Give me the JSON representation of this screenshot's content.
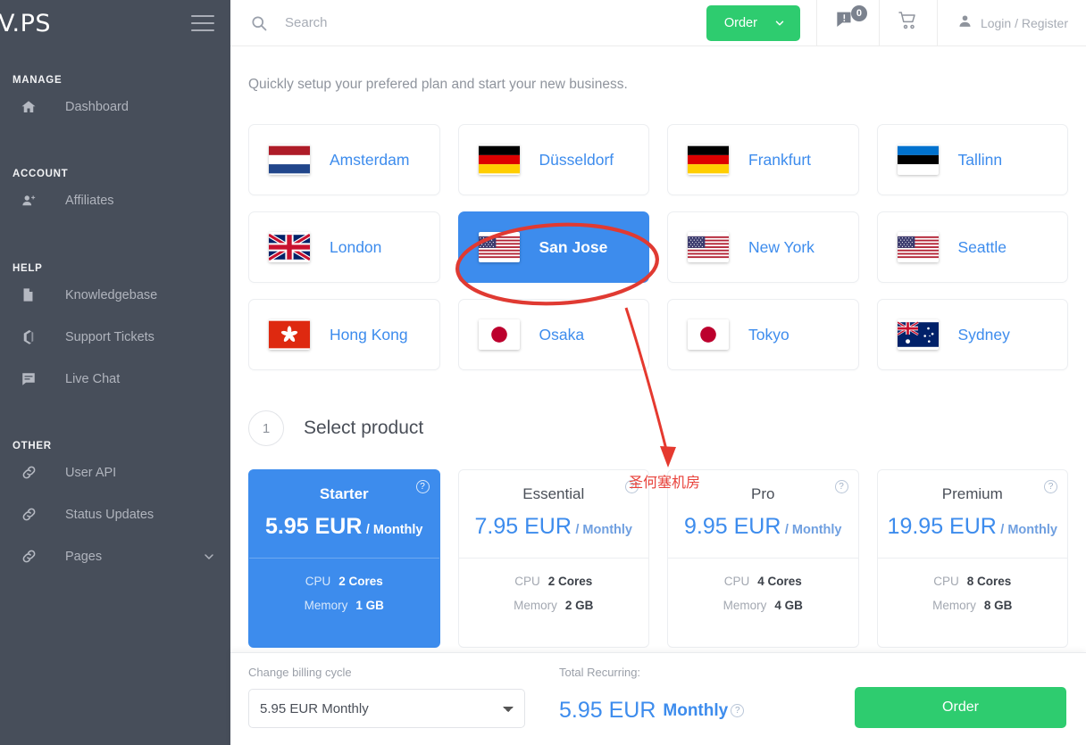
{
  "sidebar": {
    "brand": "V.PS",
    "menu_icon": "hamburger-icon",
    "sections": [
      {
        "title": "MANAGE",
        "items": [
          {
            "label": "Dashboard",
            "icon": "home-icon"
          }
        ]
      },
      {
        "title": "ACCOUNT",
        "items": [
          {
            "label": "Affiliates",
            "icon": "users-add-icon"
          }
        ]
      },
      {
        "title": "HELP",
        "items": [
          {
            "label": "Knowledgebase",
            "icon": "document-icon"
          },
          {
            "label": "Support Tickets",
            "icon": "ticket-icon"
          },
          {
            "label": "Live Chat",
            "icon": "chat-icon"
          }
        ]
      },
      {
        "title": "OTHER",
        "items": [
          {
            "label": "User API",
            "icon": "link-icon"
          },
          {
            "label": "Status Updates",
            "icon": "link-icon"
          },
          {
            "label": "Pages",
            "icon": "link-icon",
            "chevron": "chevron-down-icon"
          }
        ]
      }
    ]
  },
  "header": {
    "search_placeholder": "Search",
    "search_value": "",
    "search_icon": "search-icon",
    "order_label": "Order",
    "order_chevron": "chevron-down-icon",
    "notification_icon": "chat-alert-icon",
    "notification_count": "0",
    "cart_icon": "shopping-cart-icon",
    "account_icon": "user-icon",
    "account_label": "Login / Register"
  },
  "main": {
    "subtitle": "Quickly setup your prefered plan and start your new business.",
    "locations": [
      {
        "name": "Amsterdam",
        "flag": "nl",
        "selected": false
      },
      {
        "name": "Düsseldorf",
        "flag": "de",
        "selected": false
      },
      {
        "name": "Frankfurt",
        "flag": "de",
        "selected": false
      },
      {
        "name": "Tallinn",
        "flag": "ee",
        "selected": false
      },
      {
        "name": "London",
        "flag": "gb",
        "selected": false
      },
      {
        "name": "San Jose",
        "flag": "us",
        "selected": true
      },
      {
        "name": "New York",
        "flag": "us",
        "selected": false
      },
      {
        "name": "Seattle",
        "flag": "us",
        "selected": false
      },
      {
        "name": "Hong Kong",
        "flag": "hk",
        "selected": false
      },
      {
        "name": "Osaka",
        "flag": "jp",
        "selected": false
      },
      {
        "name": "Tokyo",
        "flag": "jp",
        "selected": false
      },
      {
        "name": "Sydney",
        "flag": "au",
        "selected": false
      }
    ],
    "step": {
      "number": "1",
      "label": "Select product"
    },
    "products": [
      {
        "name": "Starter",
        "price": "5.95 EUR",
        "period": "/ Monthly",
        "selected": true,
        "specs": [
          {
            "key": "CPU",
            "value": "2 Cores"
          },
          {
            "key": "Memory",
            "value": "1 GB"
          }
        ],
        "help": "?"
      },
      {
        "name": "Essential",
        "price": "7.95 EUR",
        "period": "/ Monthly",
        "selected": false,
        "specs": [
          {
            "key": "CPU",
            "value": "2 Cores"
          },
          {
            "key": "Memory",
            "value": "2 GB"
          }
        ],
        "help": "?"
      },
      {
        "name": "Pro",
        "price": "9.95 EUR",
        "period": "/ Monthly",
        "selected": false,
        "specs": [
          {
            "key": "CPU",
            "value": "4 Cores"
          },
          {
            "key": "Memory",
            "value": "4 GB"
          }
        ],
        "help": "?"
      },
      {
        "name": "Premium",
        "price": "19.95 EUR",
        "period": "/ Monthly",
        "selected": false,
        "specs": [
          {
            "key": "CPU",
            "value": "8 Cores"
          },
          {
            "key": "Memory",
            "value": "8 GB"
          }
        ],
        "help": "?"
      }
    ]
  },
  "bottombar": {
    "billing_label": "Change billing cycle",
    "billing_selected": "5.95 EUR Monthly",
    "billing_options": [
      "5.95 EUR Monthly"
    ],
    "total_label": "Total Recurring:",
    "total_amount": "5.95 EUR",
    "total_period": "Monthly",
    "total_help": "?",
    "order_label": "Order"
  },
  "annotation": {
    "text": "圣何塞机房",
    "color": "#e8413a",
    "ellipse_target": "San Jose",
    "arrow": "red-arrow"
  },
  "colors": {
    "sidebar_bg": "#474e5a",
    "accent_blue": "#3d8ced",
    "accent_green": "#2ecc6f",
    "annotation_red": "#e8413a",
    "muted_text": "#a7acb5"
  }
}
